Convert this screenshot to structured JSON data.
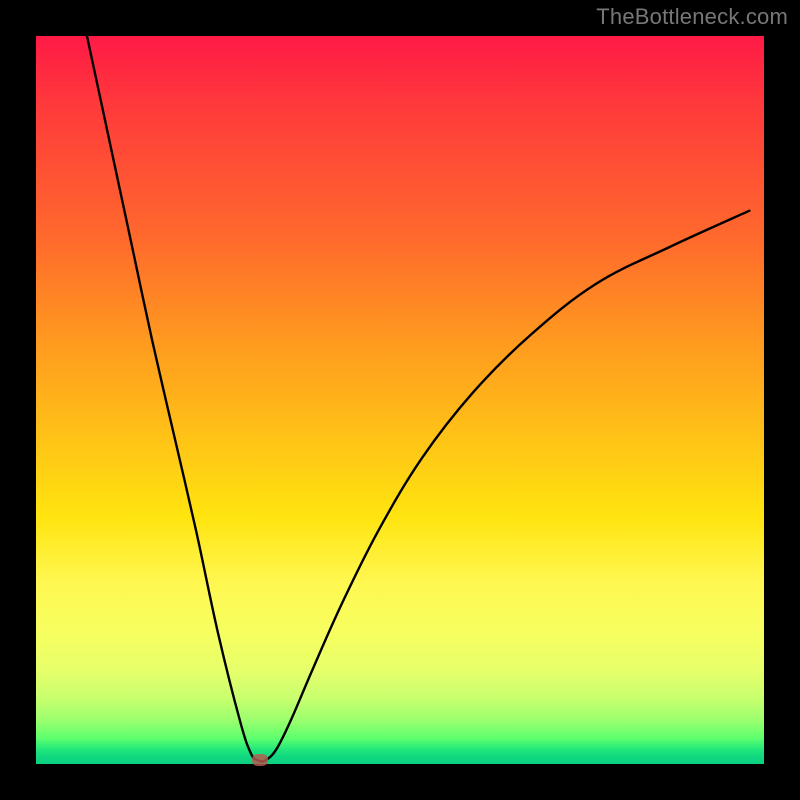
{
  "watermark": {
    "text": "TheBottleneck.com"
  },
  "chart_data": {
    "type": "line",
    "title": "",
    "xlabel": "",
    "ylabel": "",
    "xlim": [
      0,
      100
    ],
    "ylim": [
      0,
      100
    ],
    "grid": false,
    "legend": false,
    "series": [
      {
        "name": "bottleneck-curve",
        "x": [
          7,
          10,
          13,
          16,
          19,
          22,
          25,
          28,
          29.5,
          30.5,
          31.5,
          33,
          35,
          38,
          42,
          47,
          53,
          60,
          68,
          77,
          87,
          98
        ],
        "y": [
          100,
          86,
          72,
          58,
          45,
          32,
          18,
          6,
          1.5,
          0.5,
          0.5,
          2,
          6,
          13,
          22,
          32,
          42,
          51,
          59,
          66,
          71,
          76
        ]
      }
    ],
    "marker": {
      "x_pct": 30.8,
      "y_pct": 0.5,
      "name": "optimal-point"
    },
    "gradient_stops": [
      {
        "pct": 0,
        "color": "#ff1a46"
      },
      {
        "pct": 42,
        "color": "#ff9a1f"
      },
      {
        "pct": 66,
        "color": "#ffe40f"
      },
      {
        "pct": 94,
        "color": "#9bff6e"
      },
      {
        "pct": 100,
        "color": "#0ccf80"
      }
    ]
  }
}
